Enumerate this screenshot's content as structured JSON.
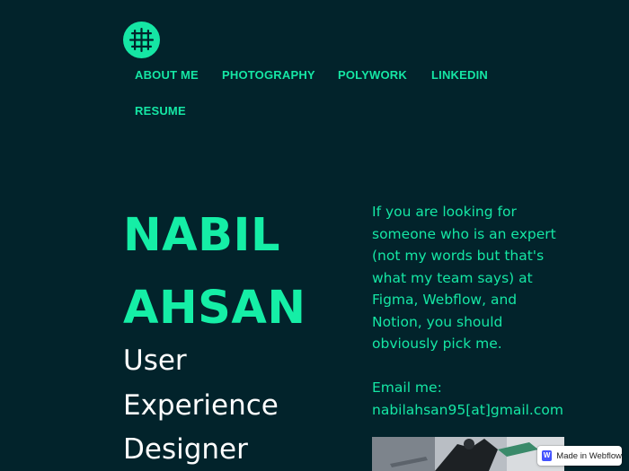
{
  "nav": {
    "items": [
      {
        "label": "ABOUT ME"
      },
      {
        "label": "PHOTOGRAPHY"
      },
      {
        "label": "POLYWORK"
      },
      {
        "label": "LINKEDIN"
      },
      {
        "label": "RESUME"
      }
    ]
  },
  "hero": {
    "name_lines": [
      "NABIL",
      "AHSAN"
    ],
    "role_lines": [
      "User",
      "Experience",
      "Designer"
    ]
  },
  "intro": {
    "lines": [
      "If you are looking for",
      "someone who is an expert",
      "(not my words but that's",
      "what my team says) at",
      "Figma, Webflow, and",
      "Notion, you should",
      "obviously pick me."
    ]
  },
  "contact": {
    "label": "Email me:",
    "email": "nabilahsan95[at]gmail.com"
  },
  "badge": {
    "icon_letter": "W",
    "label": "Made in Webflow"
  },
  "colors": {
    "background": "#02232b",
    "accent": "#15e6a4",
    "text_light": "#ffffff"
  }
}
